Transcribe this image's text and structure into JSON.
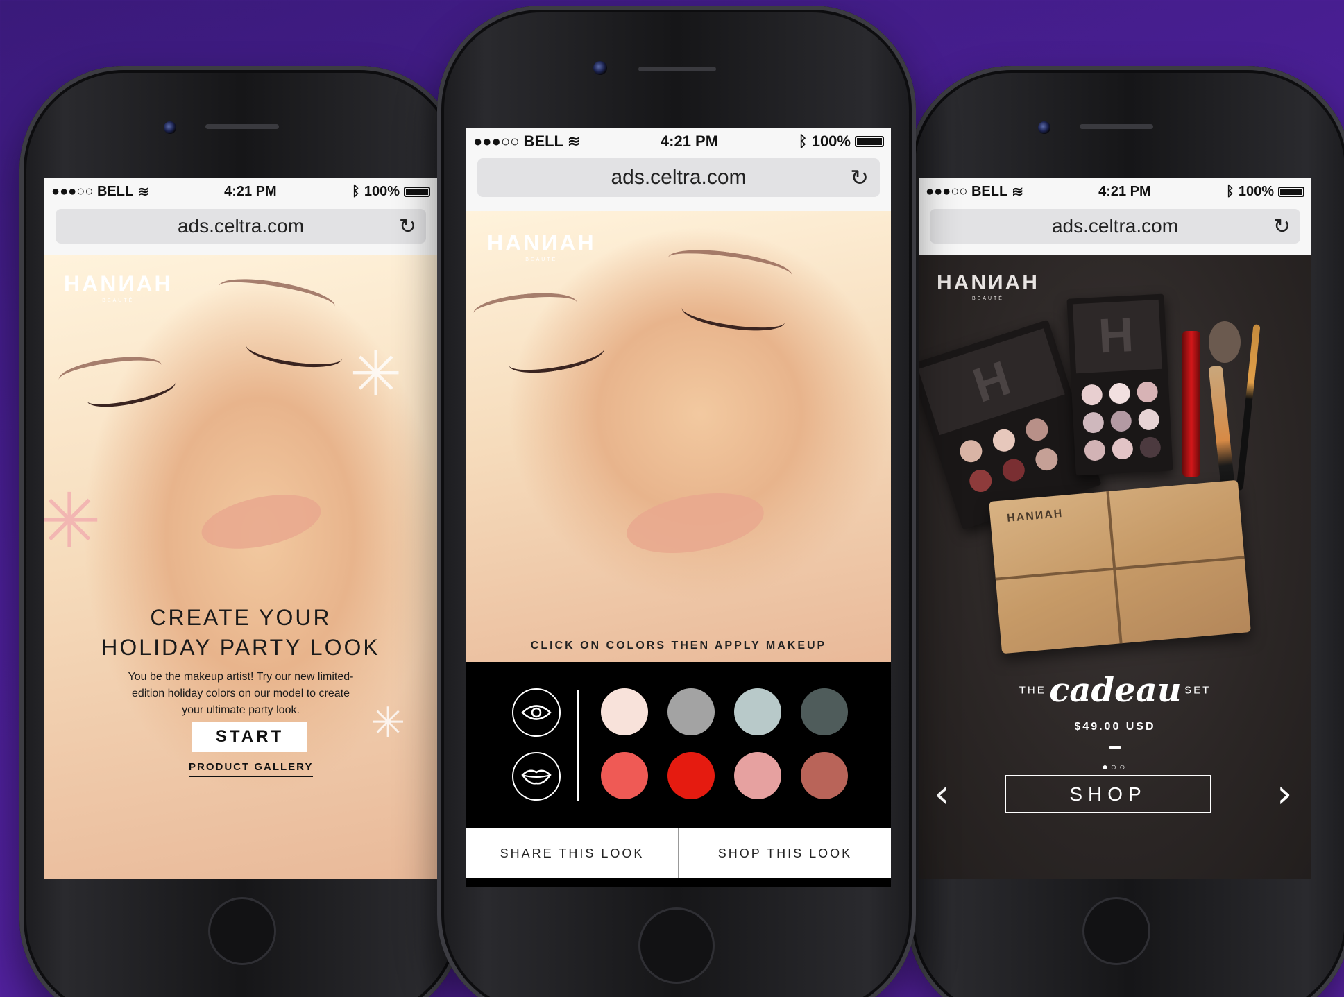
{
  "statusbar": {
    "carrier": "●●●○○ BELL",
    "wifi_icon": "wifi-icon",
    "time": "4:21 PM",
    "bluetooth_icon": "bluetooth-icon",
    "battery": "100%"
  },
  "urlbar": {
    "url": "ads.celtra.com",
    "reload_icon": "↻"
  },
  "brand": {
    "name": "HANИAH",
    "sub": "BEAUTÉ"
  },
  "phone_left": {
    "headline_1": "CREATE YOUR",
    "headline_2": "HOLIDAY PARTY LOOK",
    "body_1": "You be the makeup artist! Try our new limited-",
    "body_2": "edition holiday colors on our model to create",
    "body_3": "your ultimate party look.",
    "start_label": "START",
    "gallery_label": "PRODUCT GALLERY"
  },
  "phone_center": {
    "instruction": "CLICK ON COLORS THEN APPLY MAKEUP",
    "tools": [
      "eye-icon",
      "lips-icon"
    ],
    "swatches_row1": [
      "#f8e2da",
      "#a3a3a3",
      "#b8c9c9",
      "#4f5c5b"
    ],
    "swatches_row2": [
      "#ef5a55",
      "#e51b10",
      "#e6a1a0",
      "#b96459"
    ],
    "share_label": "SHARE THIS LOOK",
    "shop_label": "SHOP THIS LOOK"
  },
  "phone_right": {
    "gift_brand": "HANИAH",
    "title_pre": "THE",
    "title_script": "cadeau",
    "title_post": "SET",
    "price": "$49.00 USD",
    "pager": "●○○",
    "shop_label": "SHOP",
    "prev_icon": "chevron-left-icon",
    "next_icon": "chevron-right-icon"
  }
}
